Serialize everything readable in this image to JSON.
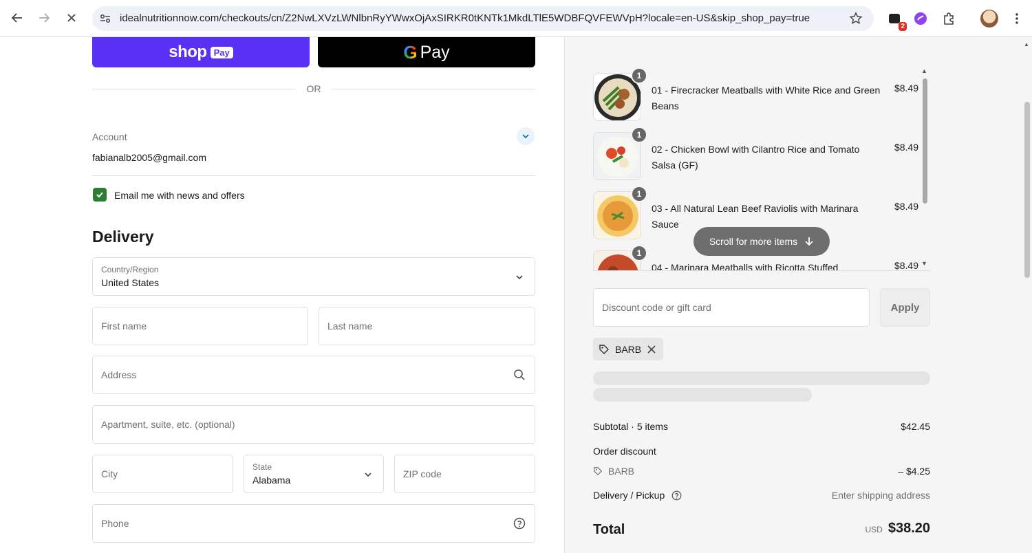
{
  "browser": {
    "url": "idealnutritionnow.com/checkouts/cn/Z2NwLXVzLWNlbnRyYWwxOjAxSIRKR0tKNTk1MkdLTlE5WDBFQVFEWVpH?locale=en-US&skip_shop_pay=true",
    "extension_badge": "2"
  },
  "express": {
    "shop_word": "shop",
    "shop_pay_box": "Pay",
    "gpay_g": "G",
    "gpay_word": "Pay",
    "or_label": "OR"
  },
  "account": {
    "label": "Account",
    "email": "fabianalb2005@gmail.com",
    "news_checkbox_label": "Email me with news and offers",
    "news_checked": true
  },
  "delivery": {
    "title": "Delivery",
    "country_label": "Country/Region",
    "country_value": "United States",
    "first_name_placeholder": "First name",
    "last_name_placeholder": "Last name",
    "address_placeholder": "Address",
    "apartment_placeholder": "Apartment, suite, etc. (optional)",
    "city_placeholder": "City",
    "state_label": "State",
    "state_value": "Alabama",
    "zip_placeholder": "ZIP code",
    "phone_placeholder": "Phone"
  },
  "cart": {
    "items": [
      {
        "qty": "1",
        "name": "01 - Firecracker Meatballs with White Rice and Green Beans",
        "price": "$8.49"
      },
      {
        "qty": "1",
        "name": "02 - Chicken Bowl with Cilantro Rice and Tomato Salsa (GF)",
        "price": "$8.49"
      },
      {
        "qty": "1",
        "name": "03 - All Natural Lean Beef Raviolis with Marinara Sauce",
        "price": "$8.49"
      },
      {
        "qty": "1",
        "name": "04 - Marinara Meatballs with Ricotta Stuffed",
        "price": "$8.49"
      }
    ],
    "scroll_hint": "Scroll for more items"
  },
  "discount": {
    "placeholder": "Discount code or gift card",
    "apply_label": "Apply",
    "applied_code": "BARB"
  },
  "summary": {
    "subtotal_label": "Subtotal · 5 items",
    "subtotal_value": "$42.45",
    "order_discount_label": "Order discount",
    "discount_code": "BARB",
    "discount_value": "– $4.25",
    "delivery_label": "Delivery / Pickup",
    "delivery_value": "Enter shipping address",
    "total_label": "Total",
    "currency": "USD",
    "total_value": "$38.20"
  }
}
